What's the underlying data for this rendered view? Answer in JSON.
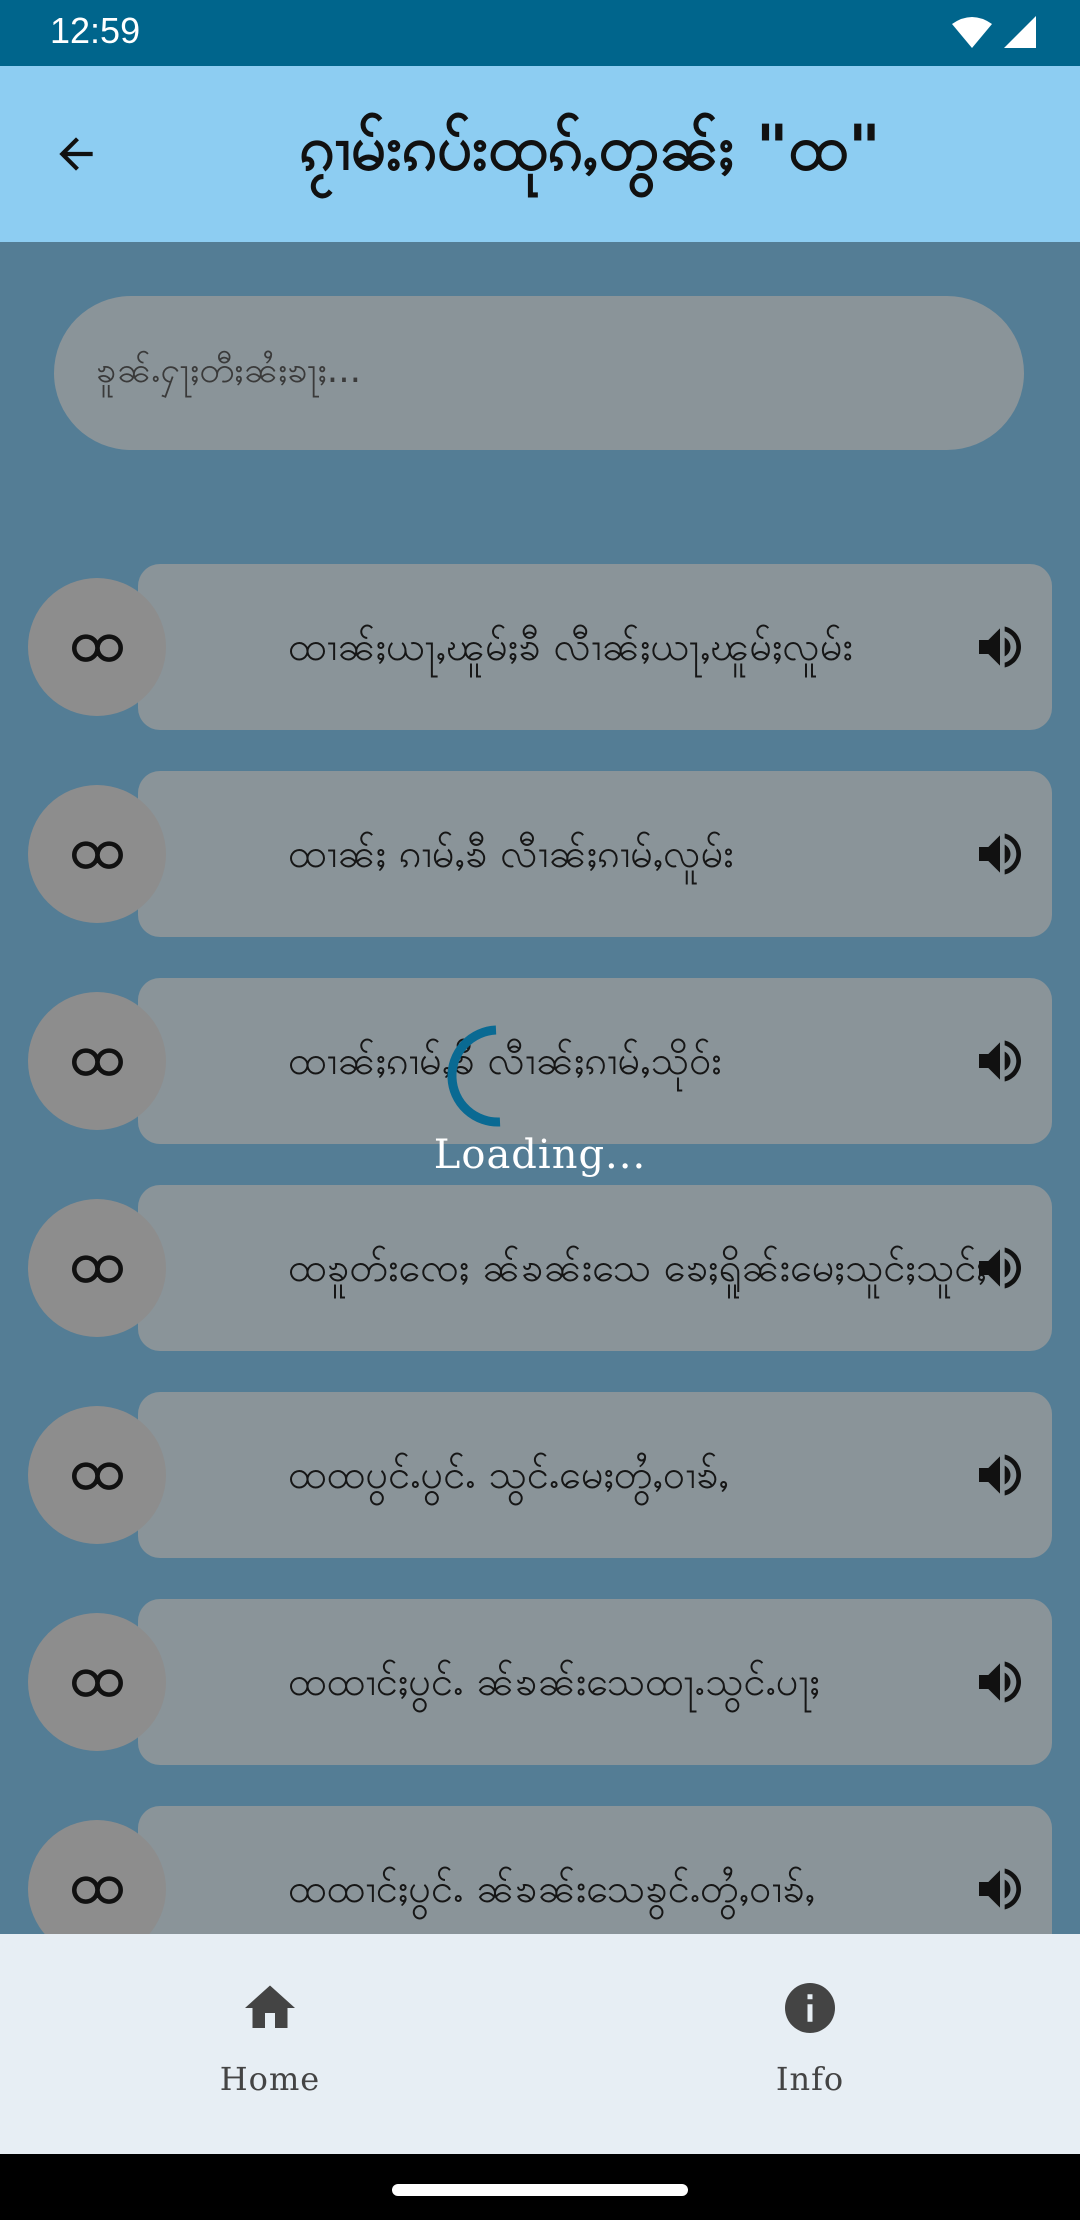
{
  "status_bar": {
    "time": "12:59"
  },
  "app_bar": {
    "title": "ၵႂၢမ်းၵပ်းထုၵ်ႇတွၼ်ႈ \"ထ\""
  },
  "search": {
    "placeholder": "ၶူၼ်ႉႁႃႈတီႈၼႆႈၶႃႈ..."
  },
  "items": [
    {
      "letter": "ထ",
      "text": "ထၢၼ်ႈယႃႇၽူမ်ႈၶီ လီၢၼ်ႈယႃႇၽူမ်ႈလူမ်း"
    },
    {
      "letter": "ထ",
      "text": "ထၢၼ်ႈ ၵၢမ်ႇၶီ လီၢၼ်ႈၵၢမ်ႇလူမ်း"
    },
    {
      "letter": "ထ",
      "text": "ထၢၼ်ႈၵၢမ်ႇၶီ လီၢၼ်ႈၵၢမ်ႇသိုဝ်း"
    },
    {
      "letter": "ထ",
      "text": "ထၶူတ်းၸေႈ ၼ်ၶၼ်းသေ ၶေႈရိူၼ်းမေႈသူင်ႈသူင်ႈ"
    },
    {
      "letter": "ထ",
      "text": "ထထပွင်ႉပွင်ႉ သွင်ႉမေႈတွႆႇဝၢၶ်ႇ"
    },
    {
      "letter": "ထ",
      "text": "ထထၢင်ႈပွင်ႉ ၼ်ၶၼ်းသေထႃႉသွင်ႉပႃႈ"
    },
    {
      "letter": "ထ",
      "text": "ထထၢင်ႈပွင်ႉ ၼ်ၶၼ်းသေၶွင်ႉတွႆႇဝၢၶ်ႇ"
    }
  ],
  "loading": {
    "text": "Loading..."
  },
  "bottom_nav": {
    "home_label": "Home",
    "info_label": "Info"
  },
  "colors": {
    "status_bar": "#00658c",
    "app_bar": "#8dcdf2",
    "background": "#547d95",
    "card": "#8a9499",
    "spinner": "#0a6a93",
    "bottom_nav": "#e7eef4"
  },
  "icons": {
    "back": "arrow-left-icon",
    "speaker": "volume-up-icon",
    "home": "home-icon",
    "info": "info-icon",
    "wifi": "wifi-icon",
    "signal": "signal-icon"
  }
}
